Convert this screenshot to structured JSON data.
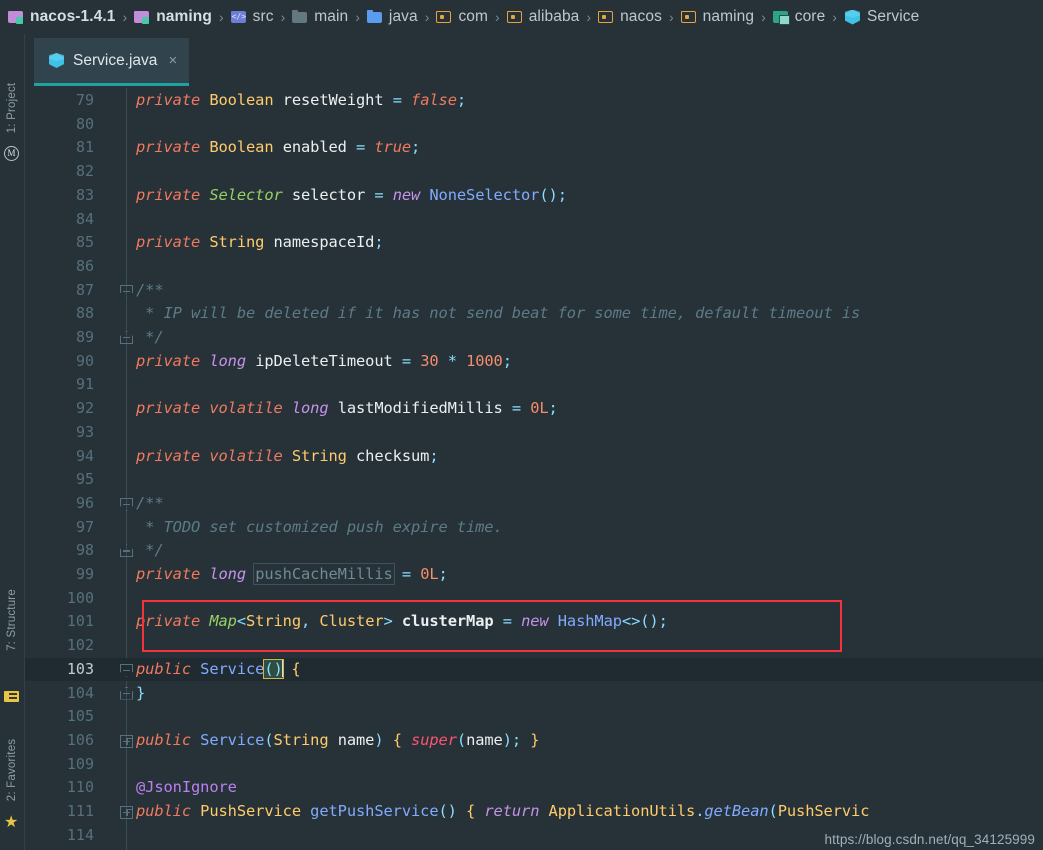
{
  "window": {
    "title": "Service.java - nacos-1.4.1",
    "theme_background": "#263238",
    "accent": "#1fa3a0",
    "callout_color": "#f5333f"
  },
  "breadcrumb": {
    "separator": "›",
    "items": [
      {
        "label": "nacos-1.4.1",
        "icon": "module-icon",
        "bold": true
      },
      {
        "label": "naming",
        "icon": "module-icon",
        "bold": true
      },
      {
        "label": "src",
        "icon": "source-root-icon",
        "bold": false
      },
      {
        "label": "main",
        "icon": "folder-gray-icon",
        "bold": false
      },
      {
        "label": "java",
        "icon": "folder-blue-icon",
        "bold": false
      },
      {
        "label": "com",
        "icon": "package-icon",
        "bold": false
      },
      {
        "label": "alibaba",
        "icon": "package-icon",
        "bold": false
      },
      {
        "label": "nacos",
        "icon": "package-icon",
        "bold": false
      },
      {
        "label": "naming",
        "icon": "package-icon",
        "bold": false
      },
      {
        "label": "core",
        "icon": "package-teal-icon",
        "bold": false
      },
      {
        "label": "Service",
        "icon": "java-class-icon",
        "bold": false
      }
    ]
  },
  "tool_window_strip": {
    "project_label": "1: Project",
    "maven_icon": "maven-icon",
    "structure_label": "7: Structure",
    "structure_icon": "structure-icon",
    "favorites_label": "2: Favorites",
    "favorites_icon": "star-icon"
  },
  "tab": {
    "label": "Service.java",
    "icon": "java-class-icon",
    "close_glyph": "×"
  },
  "editor": {
    "current_line": 103,
    "watermark": "https://blog.csdn.net/qq_34125999",
    "lines": [
      {
        "n": "79"
      },
      {
        "n": "80"
      },
      {
        "n": "81"
      },
      {
        "n": "82"
      },
      {
        "n": "83"
      },
      {
        "n": "84"
      },
      {
        "n": "85"
      },
      {
        "n": "86"
      },
      {
        "n": "87",
        "fold": "down"
      },
      {
        "n": "88"
      },
      {
        "n": "89",
        "fold": "up"
      },
      {
        "n": "90"
      },
      {
        "n": "91"
      },
      {
        "n": "92"
      },
      {
        "n": "93"
      },
      {
        "n": "94"
      },
      {
        "n": "95"
      },
      {
        "n": "96",
        "fold": "down"
      },
      {
        "n": "97"
      },
      {
        "n": "98",
        "fold": "up"
      },
      {
        "n": "99"
      },
      {
        "n": "100"
      },
      {
        "n": "101"
      },
      {
        "n": "102"
      },
      {
        "n": "103",
        "fold": "down",
        "current": true
      },
      {
        "n": "104",
        "fold": "up"
      },
      {
        "n": "105"
      },
      {
        "n": "106",
        "fold": "plus"
      },
      {
        "n": "109"
      },
      {
        "n": "110"
      },
      {
        "n": "111",
        "fold": "plus"
      },
      {
        "n": "114"
      }
    ],
    "code": [
      "    private Boolean resetWeight = false;",
      "",
      "    private Boolean enabled = true;",
      "",
      "    private Selector selector = new NoneSelector();",
      "",
      "    private String namespaceId;",
      "",
      "    /**",
      "     * IP will be deleted if it has not send beat for some time, default timeout is",
      "     */",
      "    private long ipDeleteTimeout = 30 * 1000;",
      "",
      "    private volatile long lastModifiedMillis = 0L;",
      "",
      "    private volatile String checksum;",
      "",
      "    /**",
      "     * TODO set customized push expire time.",
      "     */",
      "    private long pushCacheMillis = 0L;",
      "",
      "    private Map<String, Cluster> clusterMap = new HashMap<>();",
      "",
      "    public Service() {",
      "    }",
      "",
      "    public Service(String name) { super(name); }",
      "",
      "    @JsonIgnore",
      "    public PushService getPushService() { return ApplicationUtils.getBean(PushServic",
      ""
    ]
  },
  "callout": {
    "target_line": 101,
    "target_text": "private Map<String, Cluster> clusterMap = new HashMap<>();"
  }
}
